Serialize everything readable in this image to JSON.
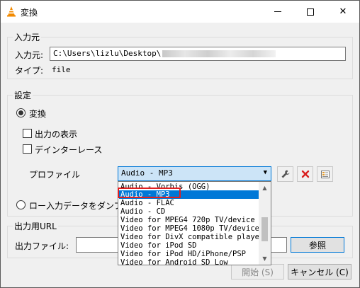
{
  "window": {
    "title": "変換",
    "icon": "vlc-cone-icon",
    "controls": {
      "minimize": "minimize-icon",
      "maximize": "maximize-icon",
      "close": "✕"
    }
  },
  "source_group": {
    "title": "入力元",
    "source_label": "入力元:",
    "source_path": "C:\\Users\\lizlu\\Desktop\\",
    "type_label": "タイプ:",
    "type_value": "file"
  },
  "settings_group": {
    "title": "設定",
    "convert_radio": {
      "label": "変換",
      "checked": true
    },
    "show_output_check": {
      "label": "出力の表示",
      "checked": false
    },
    "deinterlace_check": {
      "label": "デインターレース",
      "checked": false
    },
    "profile_label": "プロファイル",
    "profile_selected": "Audio - MP3",
    "profile_options": [
      "Audio - Vorbis (OGG)",
      "Audio - MP3",
      "Audio - FLAC",
      "Audio - CD",
      "Video for MPEG4 720p TV/device",
      "Video for MPEG4 1080p TV/device",
      "Video for DivX compatible player",
      "Video for iPod SD",
      "Video for iPod HD/iPhone/PSP",
      "Video for Android SD Low"
    ],
    "highlighted_index": 1,
    "raw_radio_label": "ロー入力データをダンプ"
  },
  "output_group": {
    "title": "出力用URL",
    "file_label": "出力ファイル:",
    "file_value": "",
    "browse_label": "参照"
  },
  "buttons": {
    "start": "開始 (S)",
    "cancel": "キャンセル (C)"
  },
  "colors": {
    "selection": "#0078d7",
    "combo_bg": "#cce4f7",
    "highlight_border": "#e02020",
    "delete_icon": "#d92020"
  }
}
